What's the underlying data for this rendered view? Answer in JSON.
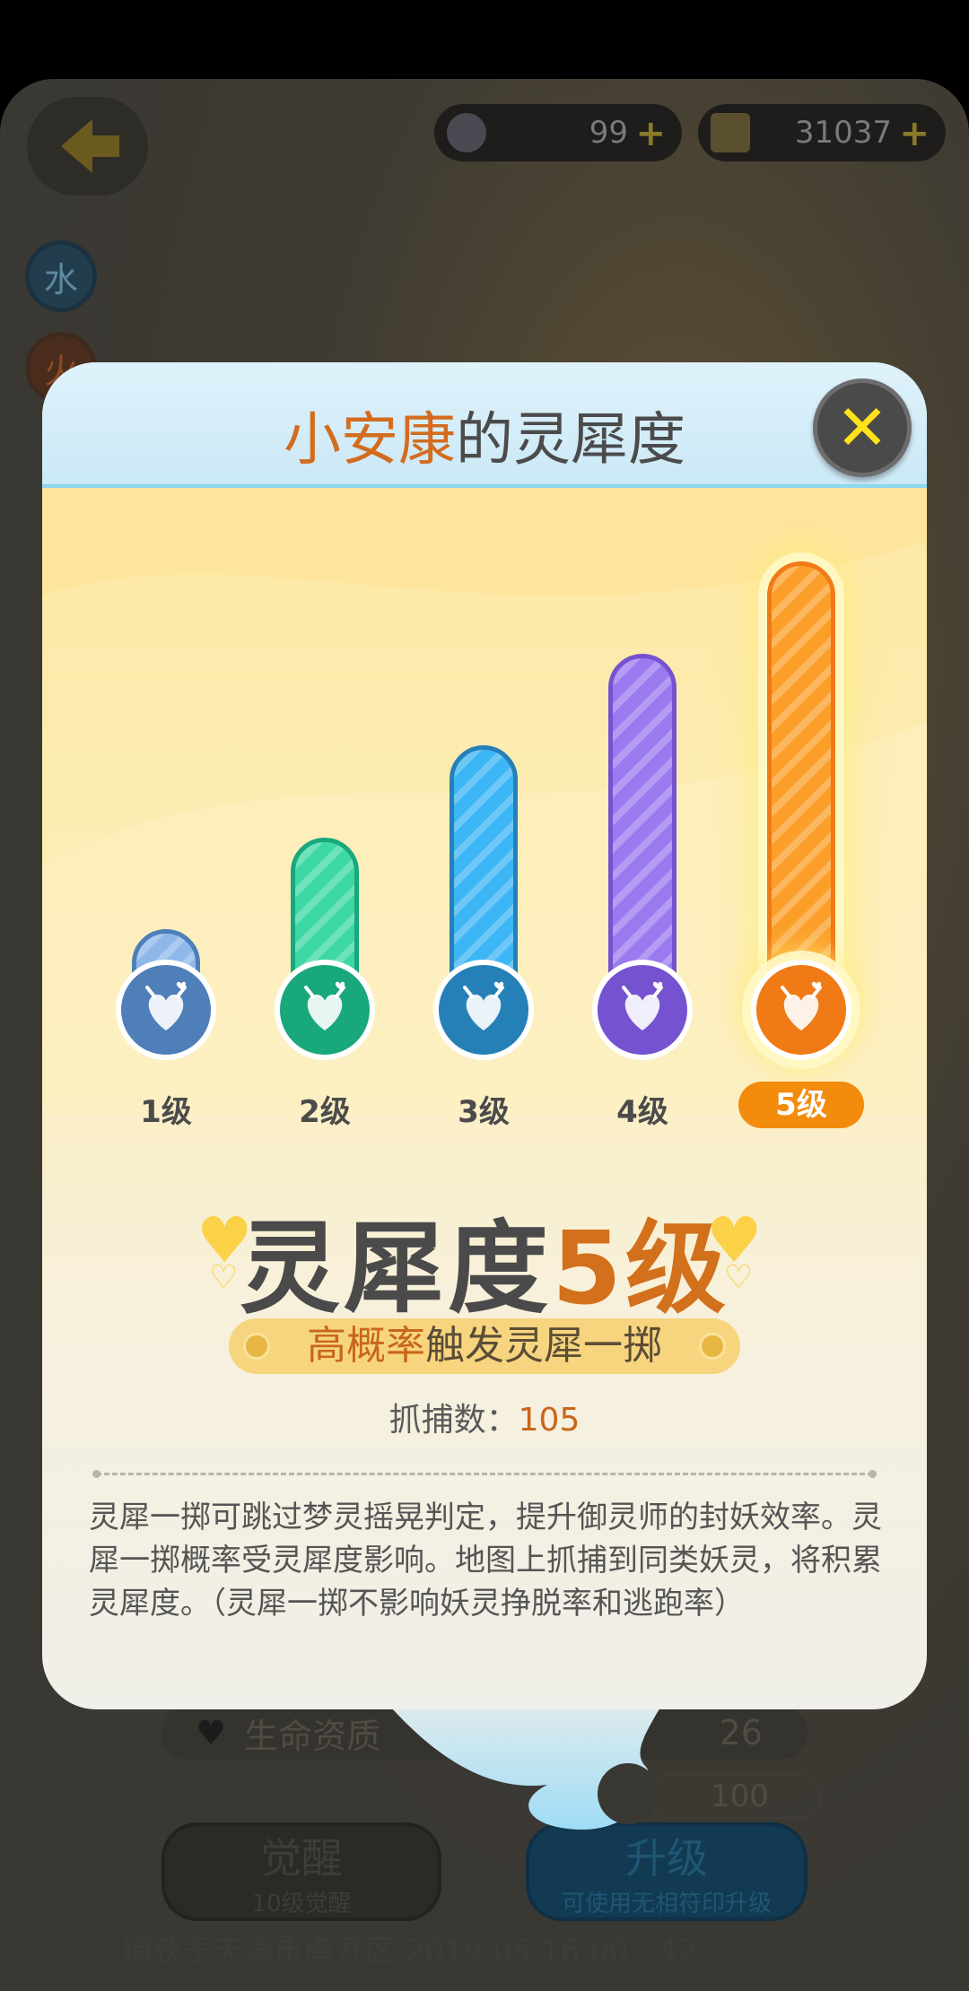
{
  "background": {
    "currency_1": "99",
    "currency_2": "31037",
    "element_1": "水",
    "element_2": "火",
    "stat_label": "生命资质",
    "stat_value": "26",
    "cost_value": "100",
    "awaken_button": {
      "label": "觉醒",
      "sub": "10级觉醒"
    },
    "upgrade_button": {
      "label": "升级",
      "sub": "可使用无相符印升级"
    },
    "footer": "捕获于天津市南开区 2019.05.16  00 : 42"
  },
  "popup": {
    "title_name": "小安康",
    "title_suffix": "的灵犀度",
    "levels": [
      {
        "label": "1级",
        "fill": 0.2,
        "color": "#8fb8ea",
        "icon_color": "#4e7fb8"
      },
      {
        "label": "2级",
        "fill": 0.4,
        "color": "#3ed8a4",
        "icon_color": "#19a77c"
      },
      {
        "label": "3级",
        "fill": 0.6,
        "color": "#3cb6f5",
        "icon_color": "#2680b8"
      },
      {
        "label": "4级",
        "fill": 0.8,
        "color": "#9b7af0",
        "icon_color": "#7552cf"
      },
      {
        "label": "5级",
        "fill": 1.0,
        "color": "#fb9f2a",
        "icon_color": "#f07a16"
      }
    ],
    "active_level": 5,
    "big_title_prefix": "灵犀度",
    "big_title_level": "5级",
    "prob_highlight": "高概率",
    "prob_text": "触发灵犀一掷",
    "catch_label": "抓捕数：",
    "catch_value": "105",
    "description": "灵犀一掷可跳过梦灵摇晃判定，提升御灵师的封妖效率。灵犀一掷概率受灵犀度影响。地图上抓捕到同类妖灵，将积累灵犀度。（灵犀一掷不影响妖灵挣脱率和逃跑率）"
  }
}
